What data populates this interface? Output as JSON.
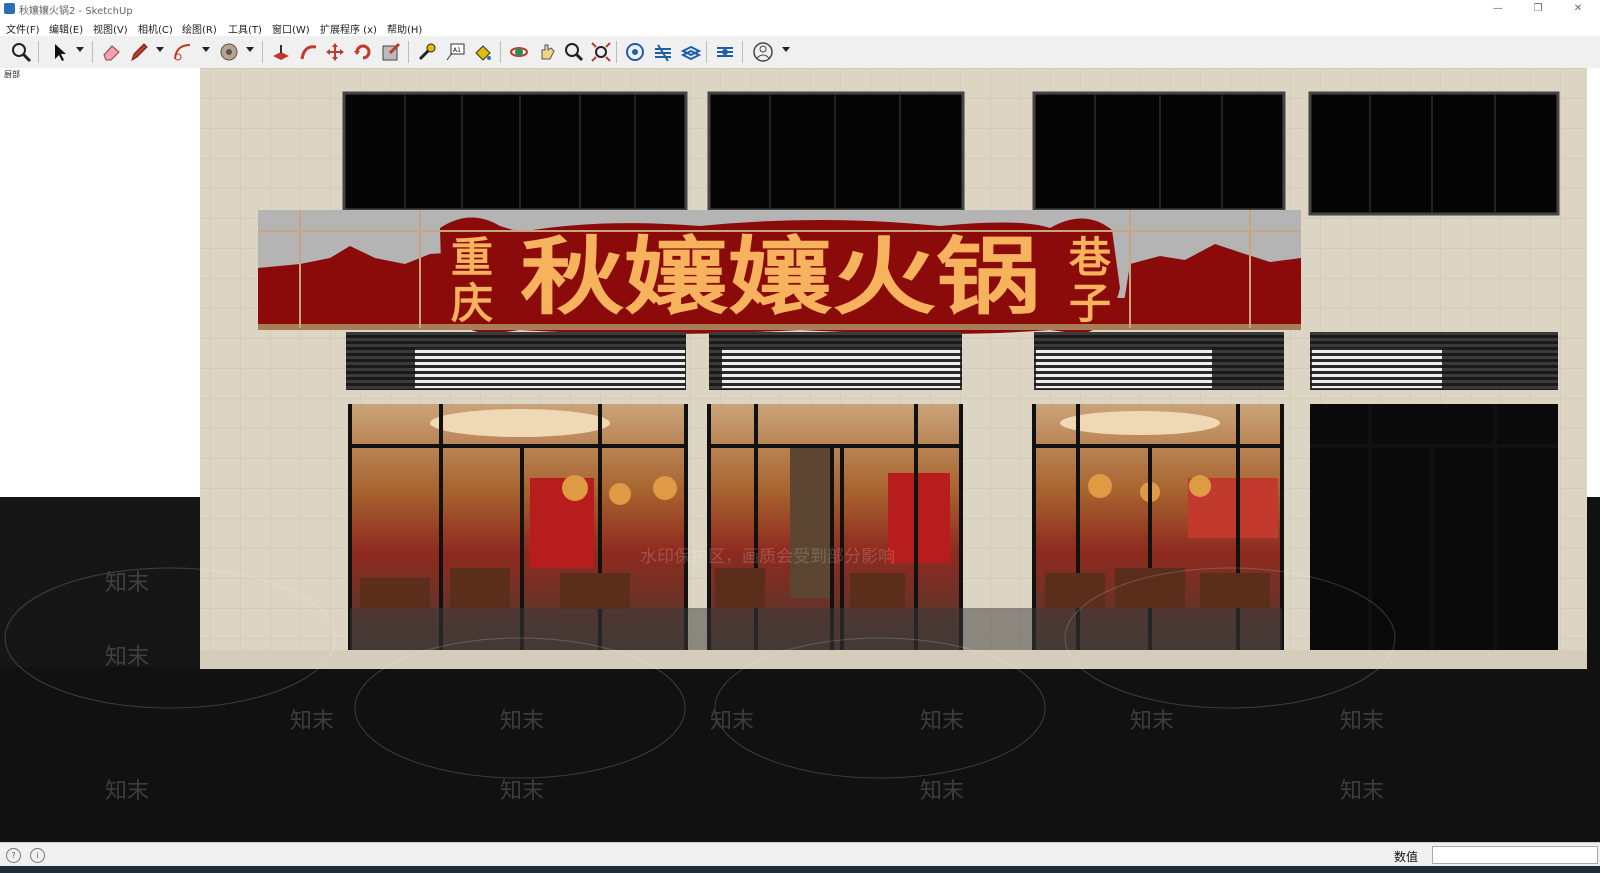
{
  "window": {
    "title": "秋孃孃火锅2 - SketchUp",
    "min_glyph": "—",
    "max_glyph": "❐",
    "close_glyph": "✕"
  },
  "menu": [
    "文件(F)",
    "编辑(E)",
    "视图(V)",
    "相机(C)",
    "绘图(R)",
    "工具(T)",
    "窗口(W)",
    "扩展程序 (x)",
    "帮助(H)"
  ],
  "toolbar": {
    "tools": [
      "zoom-icon",
      "select-icon",
      "eraser-icon",
      "pencil-icon",
      "arc-icon",
      "paint-bucket-icon",
      "push-pull-icon",
      "follow-me-icon",
      "move-icon",
      "rotate-icon",
      "scale-icon",
      "tape-measure-icon",
      "text-icon",
      "paint-icon",
      "orbit-icon",
      "pan-icon",
      "zoom-window-icon",
      "zoom-extents-icon",
      "warehouse-icon",
      "extension-warehouse-icon",
      "layout-icon",
      "extension-manager-icon",
      "account-icon"
    ],
    "text_tool_glyph": "A1"
  },
  "scene": {
    "label": "厨部",
    "sign_left": [
      "重",
      "庆"
    ],
    "sign_main": "秋孃孃火锅",
    "sign_right": [
      "巷",
      "子"
    ],
    "watermark_small": "知末",
    "watermark_center": "水印保护区，画质会受到部分影响",
    "colors": {
      "facade": "#ddd5c4",
      "sign_red": "#8b0b0b",
      "sign_text": "#f6b25c",
      "sign_grey": "#b4b4b4",
      "ground": "#111111",
      "interior": "#7a3b22"
    }
  },
  "status": {
    "vcb_label": "数值",
    "vcb_value": "",
    "icon1": "?",
    "icon2": "i"
  }
}
